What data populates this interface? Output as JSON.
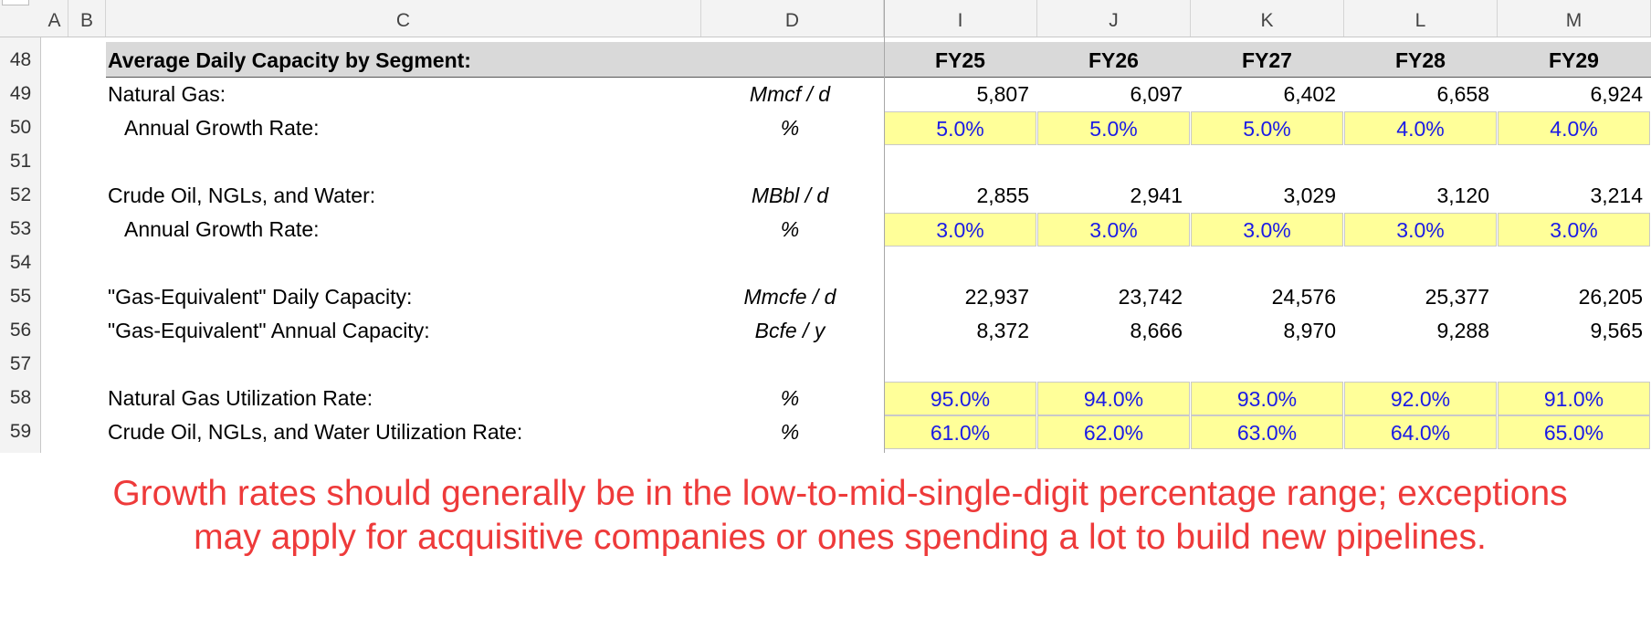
{
  "columns": [
    "A",
    "B",
    "C",
    "D",
    "I",
    "J",
    "K",
    "L",
    "M"
  ],
  "rows": [
    "48",
    "49",
    "50",
    "51",
    "52",
    "53",
    "54",
    "55",
    "56",
    "57",
    "58",
    "59"
  ],
  "section_title": "Average Daily Capacity by Segment:",
  "years": [
    "FY25",
    "FY26",
    "FY27",
    "FY28",
    "FY29"
  ],
  "lines": {
    "natural_gas": {
      "label": "Natural Gas:",
      "unit": "Mmcf / d",
      "values": [
        "5,807",
        "6,097",
        "6,402",
        "6,658",
        "6,924"
      ]
    },
    "ng_growth": {
      "label": "Annual Growth Rate:",
      "unit": "%",
      "values": [
        "5.0%",
        "5.0%",
        "5.0%",
        "4.0%",
        "4.0%"
      ]
    },
    "crude": {
      "label": "Crude Oil, NGLs, and Water:",
      "unit": "MBbl / d",
      "values": [
        "2,855",
        "2,941",
        "3,029",
        "3,120",
        "3,214"
      ]
    },
    "crude_growth": {
      "label": "Annual Growth Rate:",
      "unit": "%",
      "values": [
        "3.0%",
        "3.0%",
        "3.0%",
        "3.0%",
        "3.0%"
      ]
    },
    "gas_eq_daily": {
      "label": "\"Gas-Equivalent\" Daily Capacity:",
      "unit": "Mmcfe / d",
      "values": [
        "22,937",
        "23,742",
        "24,576",
        "25,377",
        "26,205"
      ]
    },
    "gas_eq_annual": {
      "label": "\"Gas-Equivalent\" Annual Capacity:",
      "unit": "Bcfe / y",
      "values": [
        "8,372",
        "8,666",
        "8,970",
        "9,288",
        "9,565"
      ]
    },
    "ng_util": {
      "label": "Natural Gas Utilization Rate:",
      "unit": "%",
      "values": [
        "95.0%",
        "94.0%",
        "93.0%",
        "92.0%",
        "91.0%"
      ]
    },
    "crude_util": {
      "label": "Crude Oil, NGLs, and Water Utilization Rate:",
      "unit": "%",
      "values": [
        "61.0%",
        "62.0%",
        "63.0%",
        "64.0%",
        "65.0%"
      ]
    }
  },
  "note": "Growth rates should generally be in the low-to-mid-single-digit percentage range; exceptions may apply for acquisitive companies or ones spending a lot to build new pipelines.",
  "colors": {
    "input_fill": "#ffff99",
    "input_text": "#1a1ae6",
    "note_text": "#ee3a3a",
    "header_fill": "#d9d9d9"
  }
}
